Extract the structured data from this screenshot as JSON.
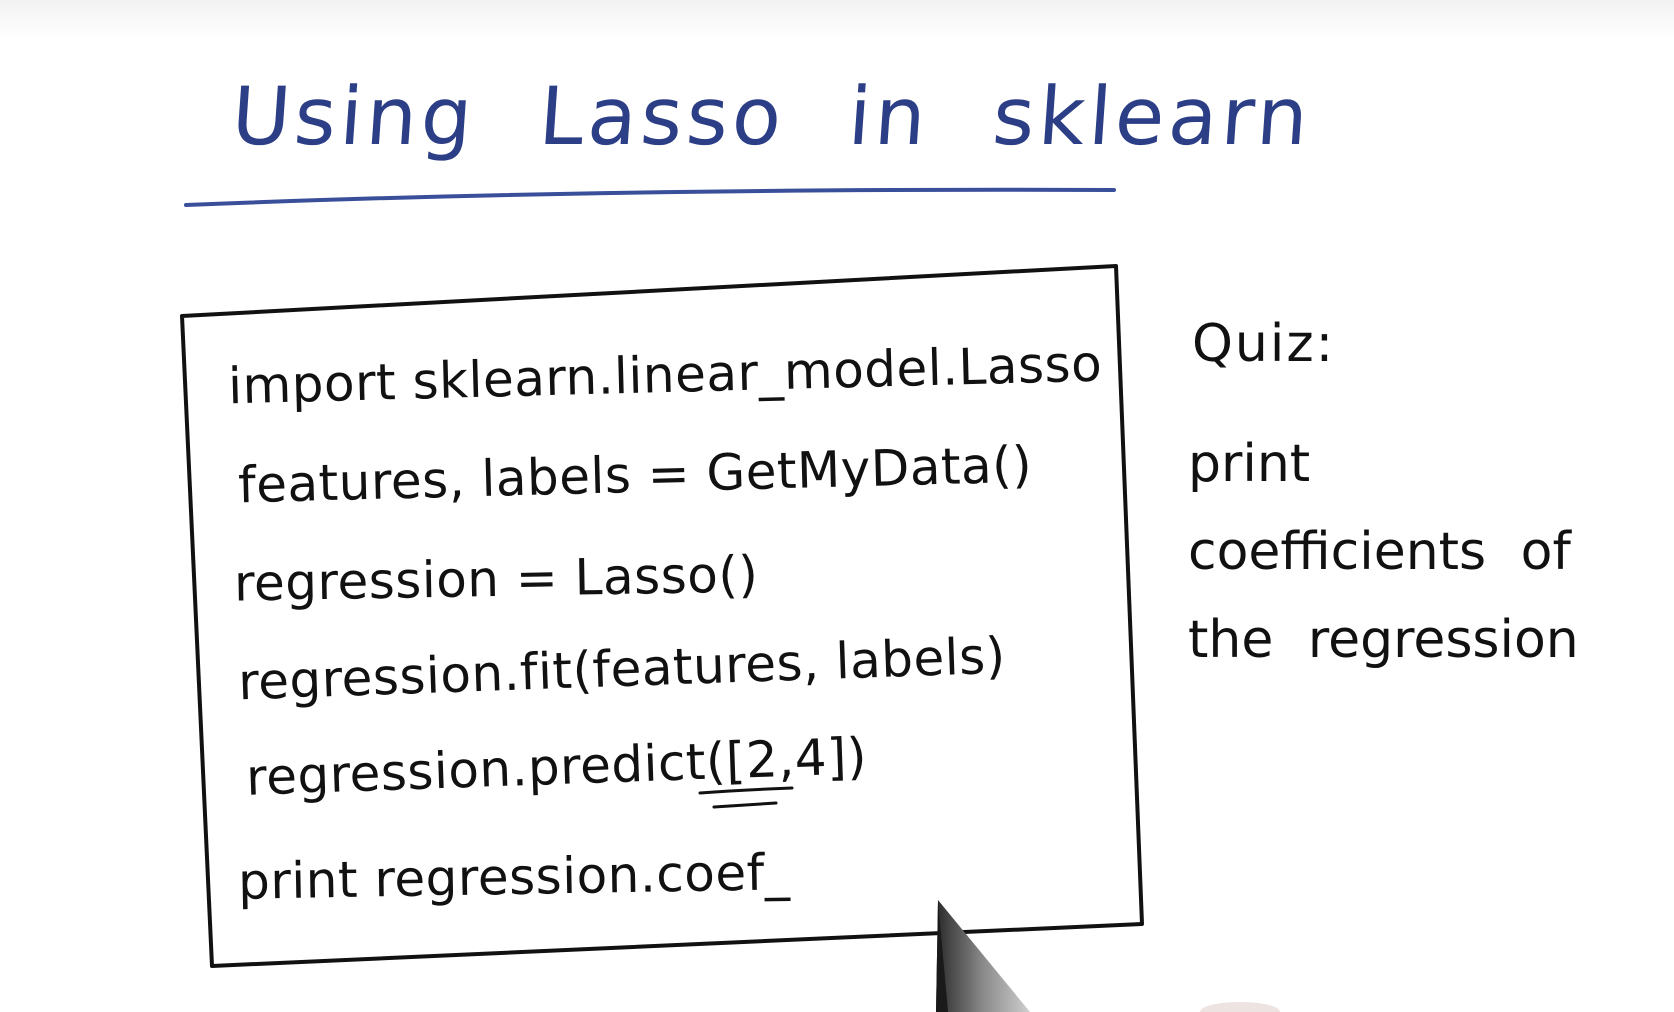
{
  "title": "Using Lasso in sklearn",
  "code": {
    "lines": [
      "import sklearn.linear_model.Lasso",
      "features, labels = GetMyData()",
      "regression = Lasso()",
      "regression.fit(features, labels)",
      "regression.predict([2,4])",
      "print regression.coef_"
    ]
  },
  "quiz": {
    "label": "Quiz:",
    "text": "print coefficients of the regression"
  },
  "colors": {
    "title_ink": "#2c3f86",
    "ink": "#111111",
    "background": "#ffffff"
  },
  "icons": {
    "pen": "pen-tip-icon"
  }
}
